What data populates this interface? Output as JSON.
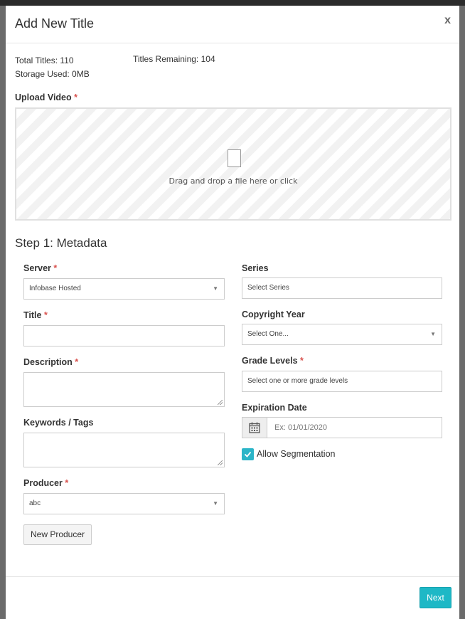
{
  "modal": {
    "title": "Add New Title",
    "close_label": "x"
  },
  "stats": {
    "total_titles": "Total Titles: 110",
    "storage_used": "Storage Used: 0MB",
    "titles_remaining": "Titles Remaining: 104"
  },
  "upload": {
    "label": "Upload Video",
    "required": "*",
    "drop_text": "Drag and drop a file here or click"
  },
  "step": {
    "title": "Step 1: Metadata"
  },
  "left": {
    "server": {
      "label": "Server",
      "required": "*",
      "value": "Infobase Hosted"
    },
    "title": {
      "label": "Title",
      "required": "*",
      "value": ""
    },
    "description": {
      "label": "Description",
      "required": "*",
      "value": ""
    },
    "keywords": {
      "label": "Keywords / Tags",
      "value": ""
    },
    "producer": {
      "label": "Producer",
      "required": "*",
      "value": "abc"
    },
    "new_producer_label": "New Producer"
  },
  "right": {
    "series": {
      "label": "Series",
      "placeholder": "Select Series"
    },
    "copyright": {
      "label": "Copyright Year",
      "value": "Select One..."
    },
    "grade": {
      "label": "Grade Levels",
      "required": "*",
      "placeholder": "Select one or more grade levels"
    },
    "expiration": {
      "label": "Expiration Date",
      "placeholder": "Ex: 01/01/2020"
    },
    "segmentation": {
      "label": "Allow Segmentation",
      "checked": true
    }
  },
  "footer": {
    "next_label": "Next"
  },
  "icons": {
    "close": "close-icon",
    "file": "file-icon",
    "caret": "chevron-down-icon",
    "calendar": "calendar-icon",
    "check": "check-icon"
  },
  "colors": {
    "accent": "#1eb8c6",
    "required": "#d9534f"
  }
}
